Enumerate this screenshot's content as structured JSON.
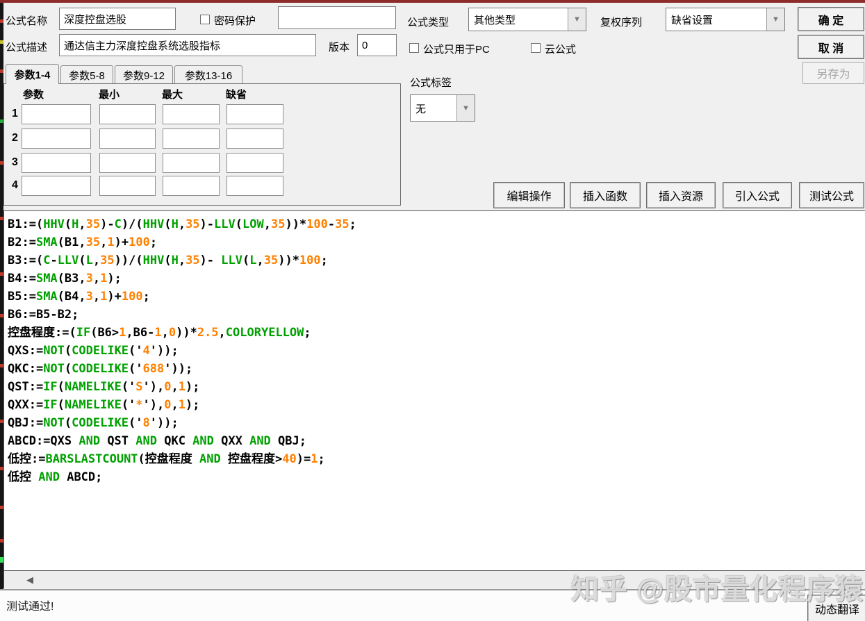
{
  "header": {
    "formula_name_label": "公式名称",
    "formula_name_value": "深度控盘选股",
    "password_protect_label": "密码保护",
    "password_value": "",
    "formula_desc_label": "公式描述",
    "formula_desc_value": "通达信主力深度控盘系统选股指标",
    "version_label": "版本",
    "version_value": "0",
    "formula_type_label": "公式类型",
    "formula_type_value": "其他类型",
    "adjust_series_label": "复权序列",
    "adjust_series_value": "缺省设置",
    "pc_only_label": "公式只用于PC",
    "cloud_formula_label": "云公式",
    "ok_button": "确 定",
    "cancel_button": "取 消",
    "save_as_button": "另存为"
  },
  "tabs": [
    {
      "label": "参数1-4",
      "active": true
    },
    {
      "label": "参数5-8",
      "active": false
    },
    {
      "label": "参数9-12",
      "active": false
    },
    {
      "label": "参数13-16",
      "active": false
    }
  ],
  "params": {
    "col_headers": [
      "参数",
      "最小",
      "最大",
      "缺省"
    ],
    "row_labels": [
      "1",
      "2",
      "3",
      "4"
    ],
    "values": [
      [
        "",
        "",
        "",
        ""
      ],
      [
        "",
        "",
        "",
        ""
      ],
      [
        "",
        "",
        "",
        ""
      ],
      [
        "",
        "",
        "",
        ""
      ]
    ]
  },
  "tag_section": {
    "label": "公式标签",
    "value": "无"
  },
  "toolbar": {
    "buttons": [
      "编辑操作",
      "插入函数",
      "插入资源",
      "引入公式",
      "测试公式"
    ]
  },
  "code": {
    "syntax_colors": {
      "keyword": "#00a000",
      "number": "#ff8000",
      "default": "#000000"
    },
    "lines": [
      [
        {
          "c": "k",
          "t": "B1:=("
        },
        {
          "c": "g",
          "t": "HHV"
        },
        {
          "c": "k",
          "t": "("
        },
        {
          "c": "g",
          "t": "H"
        },
        {
          "c": "k",
          "t": ","
        },
        {
          "c": "o",
          "t": "35"
        },
        {
          "c": "k",
          "t": ")-"
        },
        {
          "c": "g",
          "t": "C"
        },
        {
          "c": "k",
          "t": ")/("
        },
        {
          "c": "g",
          "t": "HHV"
        },
        {
          "c": "k",
          "t": "("
        },
        {
          "c": "g",
          "t": "H"
        },
        {
          "c": "k",
          "t": ","
        },
        {
          "c": "o",
          "t": "35"
        },
        {
          "c": "k",
          "t": ")-"
        },
        {
          "c": "g",
          "t": "LLV"
        },
        {
          "c": "k",
          "t": "("
        },
        {
          "c": "g",
          "t": "LOW"
        },
        {
          "c": "k",
          "t": ","
        },
        {
          "c": "o",
          "t": "35"
        },
        {
          "c": "k",
          "t": "))*"
        },
        {
          "c": "o",
          "t": "100"
        },
        {
          "c": "k",
          "t": "-"
        },
        {
          "c": "o",
          "t": "35"
        },
        {
          "c": "k",
          "t": ";"
        }
      ],
      [
        {
          "c": "k",
          "t": "B2:="
        },
        {
          "c": "g",
          "t": "SMA"
        },
        {
          "c": "k",
          "t": "(B1,"
        },
        {
          "c": "o",
          "t": "35"
        },
        {
          "c": "k",
          "t": ","
        },
        {
          "c": "o",
          "t": "1"
        },
        {
          "c": "k",
          "t": ")+"
        },
        {
          "c": "o",
          "t": "100"
        },
        {
          "c": "k",
          "t": ";"
        }
      ],
      [
        {
          "c": "k",
          "t": "B3:=("
        },
        {
          "c": "g",
          "t": "C"
        },
        {
          "c": "k",
          "t": "-"
        },
        {
          "c": "g",
          "t": "LLV"
        },
        {
          "c": "k",
          "t": "("
        },
        {
          "c": "g",
          "t": "L"
        },
        {
          "c": "k",
          "t": ","
        },
        {
          "c": "o",
          "t": "35"
        },
        {
          "c": "k",
          "t": "))/("
        },
        {
          "c": "g",
          "t": "HHV"
        },
        {
          "c": "k",
          "t": "("
        },
        {
          "c": "g",
          "t": "H"
        },
        {
          "c": "k",
          "t": ","
        },
        {
          "c": "o",
          "t": "35"
        },
        {
          "c": "k",
          "t": ")- "
        },
        {
          "c": "g",
          "t": "LLV"
        },
        {
          "c": "k",
          "t": "("
        },
        {
          "c": "g",
          "t": "L"
        },
        {
          "c": "k",
          "t": ","
        },
        {
          "c": "o",
          "t": "35"
        },
        {
          "c": "k",
          "t": "))*"
        },
        {
          "c": "o",
          "t": "100"
        },
        {
          "c": "k",
          "t": ";"
        }
      ],
      [
        {
          "c": "k",
          "t": "B4:="
        },
        {
          "c": "g",
          "t": "SMA"
        },
        {
          "c": "k",
          "t": "(B3,"
        },
        {
          "c": "o",
          "t": "3"
        },
        {
          "c": "k",
          "t": ","
        },
        {
          "c": "o",
          "t": "1"
        },
        {
          "c": "k",
          "t": ");"
        }
      ],
      [
        {
          "c": "k",
          "t": "B5:="
        },
        {
          "c": "g",
          "t": "SMA"
        },
        {
          "c": "k",
          "t": "(B4,"
        },
        {
          "c": "o",
          "t": "3"
        },
        {
          "c": "k",
          "t": ","
        },
        {
          "c": "o",
          "t": "1"
        },
        {
          "c": "k",
          "t": ")+"
        },
        {
          "c": "o",
          "t": "100"
        },
        {
          "c": "k",
          "t": ";"
        }
      ],
      [
        {
          "c": "k",
          "t": "B6:=B5-B2;"
        }
      ],
      [
        {
          "c": "k",
          "t": "控盘程度:=("
        },
        {
          "c": "g",
          "t": "IF"
        },
        {
          "c": "k",
          "t": "(B6>"
        },
        {
          "c": "o",
          "t": "1"
        },
        {
          "c": "k",
          "t": ",B6-"
        },
        {
          "c": "o",
          "t": "1"
        },
        {
          "c": "k",
          "t": ","
        },
        {
          "c": "o",
          "t": "0"
        },
        {
          "c": "k",
          "t": "))*"
        },
        {
          "c": "o",
          "t": "2.5"
        },
        {
          "c": "k",
          "t": ","
        },
        {
          "c": "g",
          "t": "COLORYELLOW"
        },
        {
          "c": "k",
          "t": ";"
        }
      ],
      [
        {
          "c": "k",
          "t": "QXS:="
        },
        {
          "c": "g",
          "t": "NOT"
        },
        {
          "c": "k",
          "t": "("
        },
        {
          "c": "g",
          "t": "CODELIKE"
        },
        {
          "c": "k",
          "t": "('"
        },
        {
          "c": "o",
          "t": "4"
        },
        {
          "c": "k",
          "t": "'));"
        }
      ],
      [
        {
          "c": "k",
          "t": "QKC:="
        },
        {
          "c": "g",
          "t": "NOT"
        },
        {
          "c": "k",
          "t": "("
        },
        {
          "c": "g",
          "t": "CODELIKE"
        },
        {
          "c": "k",
          "t": "('"
        },
        {
          "c": "o",
          "t": "688"
        },
        {
          "c": "k",
          "t": "'));"
        }
      ],
      [
        {
          "c": "k",
          "t": "QST:="
        },
        {
          "c": "g",
          "t": "IF"
        },
        {
          "c": "k",
          "t": "("
        },
        {
          "c": "g",
          "t": "NAMELIKE"
        },
        {
          "c": "k",
          "t": "('"
        },
        {
          "c": "o",
          "t": "S"
        },
        {
          "c": "k",
          "t": "'),"
        },
        {
          "c": "o",
          "t": "0"
        },
        {
          "c": "k",
          "t": ","
        },
        {
          "c": "o",
          "t": "1"
        },
        {
          "c": "k",
          "t": ");"
        }
      ],
      [
        {
          "c": "k",
          "t": "QXX:="
        },
        {
          "c": "g",
          "t": "IF"
        },
        {
          "c": "k",
          "t": "("
        },
        {
          "c": "g",
          "t": "NAMELIKE"
        },
        {
          "c": "k",
          "t": "('"
        },
        {
          "c": "o",
          "t": "*"
        },
        {
          "c": "k",
          "t": "'),"
        },
        {
          "c": "o",
          "t": "0"
        },
        {
          "c": "k",
          "t": ","
        },
        {
          "c": "o",
          "t": "1"
        },
        {
          "c": "k",
          "t": ");"
        }
      ],
      [
        {
          "c": "k",
          "t": "QBJ:="
        },
        {
          "c": "g",
          "t": "NOT"
        },
        {
          "c": "k",
          "t": "("
        },
        {
          "c": "g",
          "t": "CODELIKE"
        },
        {
          "c": "k",
          "t": "('"
        },
        {
          "c": "o",
          "t": "8"
        },
        {
          "c": "k",
          "t": "'));"
        }
      ],
      [
        {
          "c": "k",
          "t": "ABCD:=QXS "
        },
        {
          "c": "g",
          "t": "AND"
        },
        {
          "c": "k",
          "t": " QST "
        },
        {
          "c": "g",
          "t": "AND"
        },
        {
          "c": "k",
          "t": " QKC "
        },
        {
          "c": "g",
          "t": "AND"
        },
        {
          "c": "k",
          "t": " QXX "
        },
        {
          "c": "g",
          "t": "AND"
        },
        {
          "c": "k",
          "t": " QBJ;"
        }
      ],
      [
        {
          "c": "k",
          "t": "低控:="
        },
        {
          "c": "g",
          "t": "BARSLASTCOUNT"
        },
        {
          "c": "k",
          "t": "(控盘程度 "
        },
        {
          "c": "g",
          "t": "AND"
        },
        {
          "c": "k",
          "t": " 控盘程度>"
        },
        {
          "c": "o",
          "t": "40"
        },
        {
          "c": "k",
          "t": ")="
        },
        {
          "c": "o",
          "t": "1"
        },
        {
          "c": "k",
          "t": ";"
        }
      ],
      [
        {
          "c": "k",
          "t": "低控 "
        },
        {
          "c": "g",
          "t": "AND"
        },
        {
          "c": "k",
          "t": " ABCD;"
        }
      ]
    ]
  },
  "status_bar": {
    "message": "测试通过!",
    "translate_button": "动态翻译"
  },
  "watermark": "知乎 @股市量化程序猿",
  "colors": {
    "dialog_bg": "#f0f0f0",
    "top_edge": "#8e2b2b",
    "keyword_green": "#00a000",
    "number_orange": "#ff8000"
  }
}
